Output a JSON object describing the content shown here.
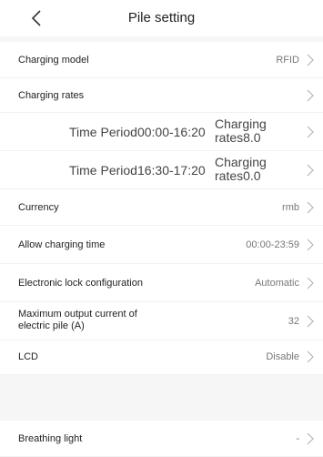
{
  "header": {
    "title": "Pile setting",
    "back_icon": "chevron-left-icon"
  },
  "rows": {
    "charging_model": {
      "label": "Charging model",
      "value": "RFID"
    },
    "charging_rates": {
      "label": "Charging rates"
    },
    "rate_periods": [
      {
        "period": "Time Period00:00-16:20",
        "rate_line1": "Charging",
        "rate_line2": "rates8.0"
      },
      {
        "period": "Time Period16:30-17:20",
        "rate_line1": "Charging",
        "rate_line2": "rates0.0"
      }
    ],
    "currency": {
      "label": "Currency",
      "value": "rmb"
    },
    "allow_time": {
      "label": "Allow charging time",
      "value": "00:00-23:59"
    },
    "lock_config": {
      "label": "Electronic lock configuration",
      "value": "Automatic"
    },
    "max_current": {
      "label_line1": "Maximum output current of",
      "label_line2": "electric pile (A)",
      "value": "32"
    },
    "lcd": {
      "label": "LCD",
      "value": "Disable"
    },
    "breathing_light": {
      "label": "Breathing light",
      "value": "-"
    }
  },
  "colors": {
    "background": "#f6f6f6",
    "row": "#ffffff",
    "value_text": "#777777",
    "chevron": "#b5b5b5"
  }
}
